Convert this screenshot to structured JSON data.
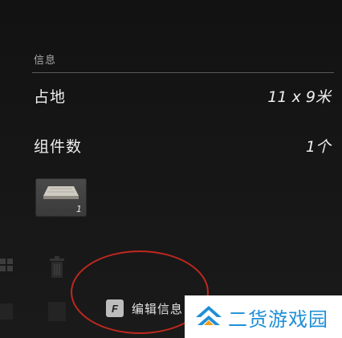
{
  "info_panel": {
    "section_title": "信息",
    "footprint": {
      "label": "占地",
      "value": "11 x 9米"
    },
    "components": {
      "label": "组件数",
      "value": "1个"
    },
    "component_tile": {
      "count": "1"
    }
  },
  "footer": {
    "key_hint": "F",
    "edit_label": "编辑信息"
  },
  "watermark": {
    "text": "二货游戏园"
  },
  "colors": {
    "background": "#141414",
    "text": "#efefef",
    "annotation": "#c0281f",
    "watermark_blue": "#1f8fd6"
  }
}
